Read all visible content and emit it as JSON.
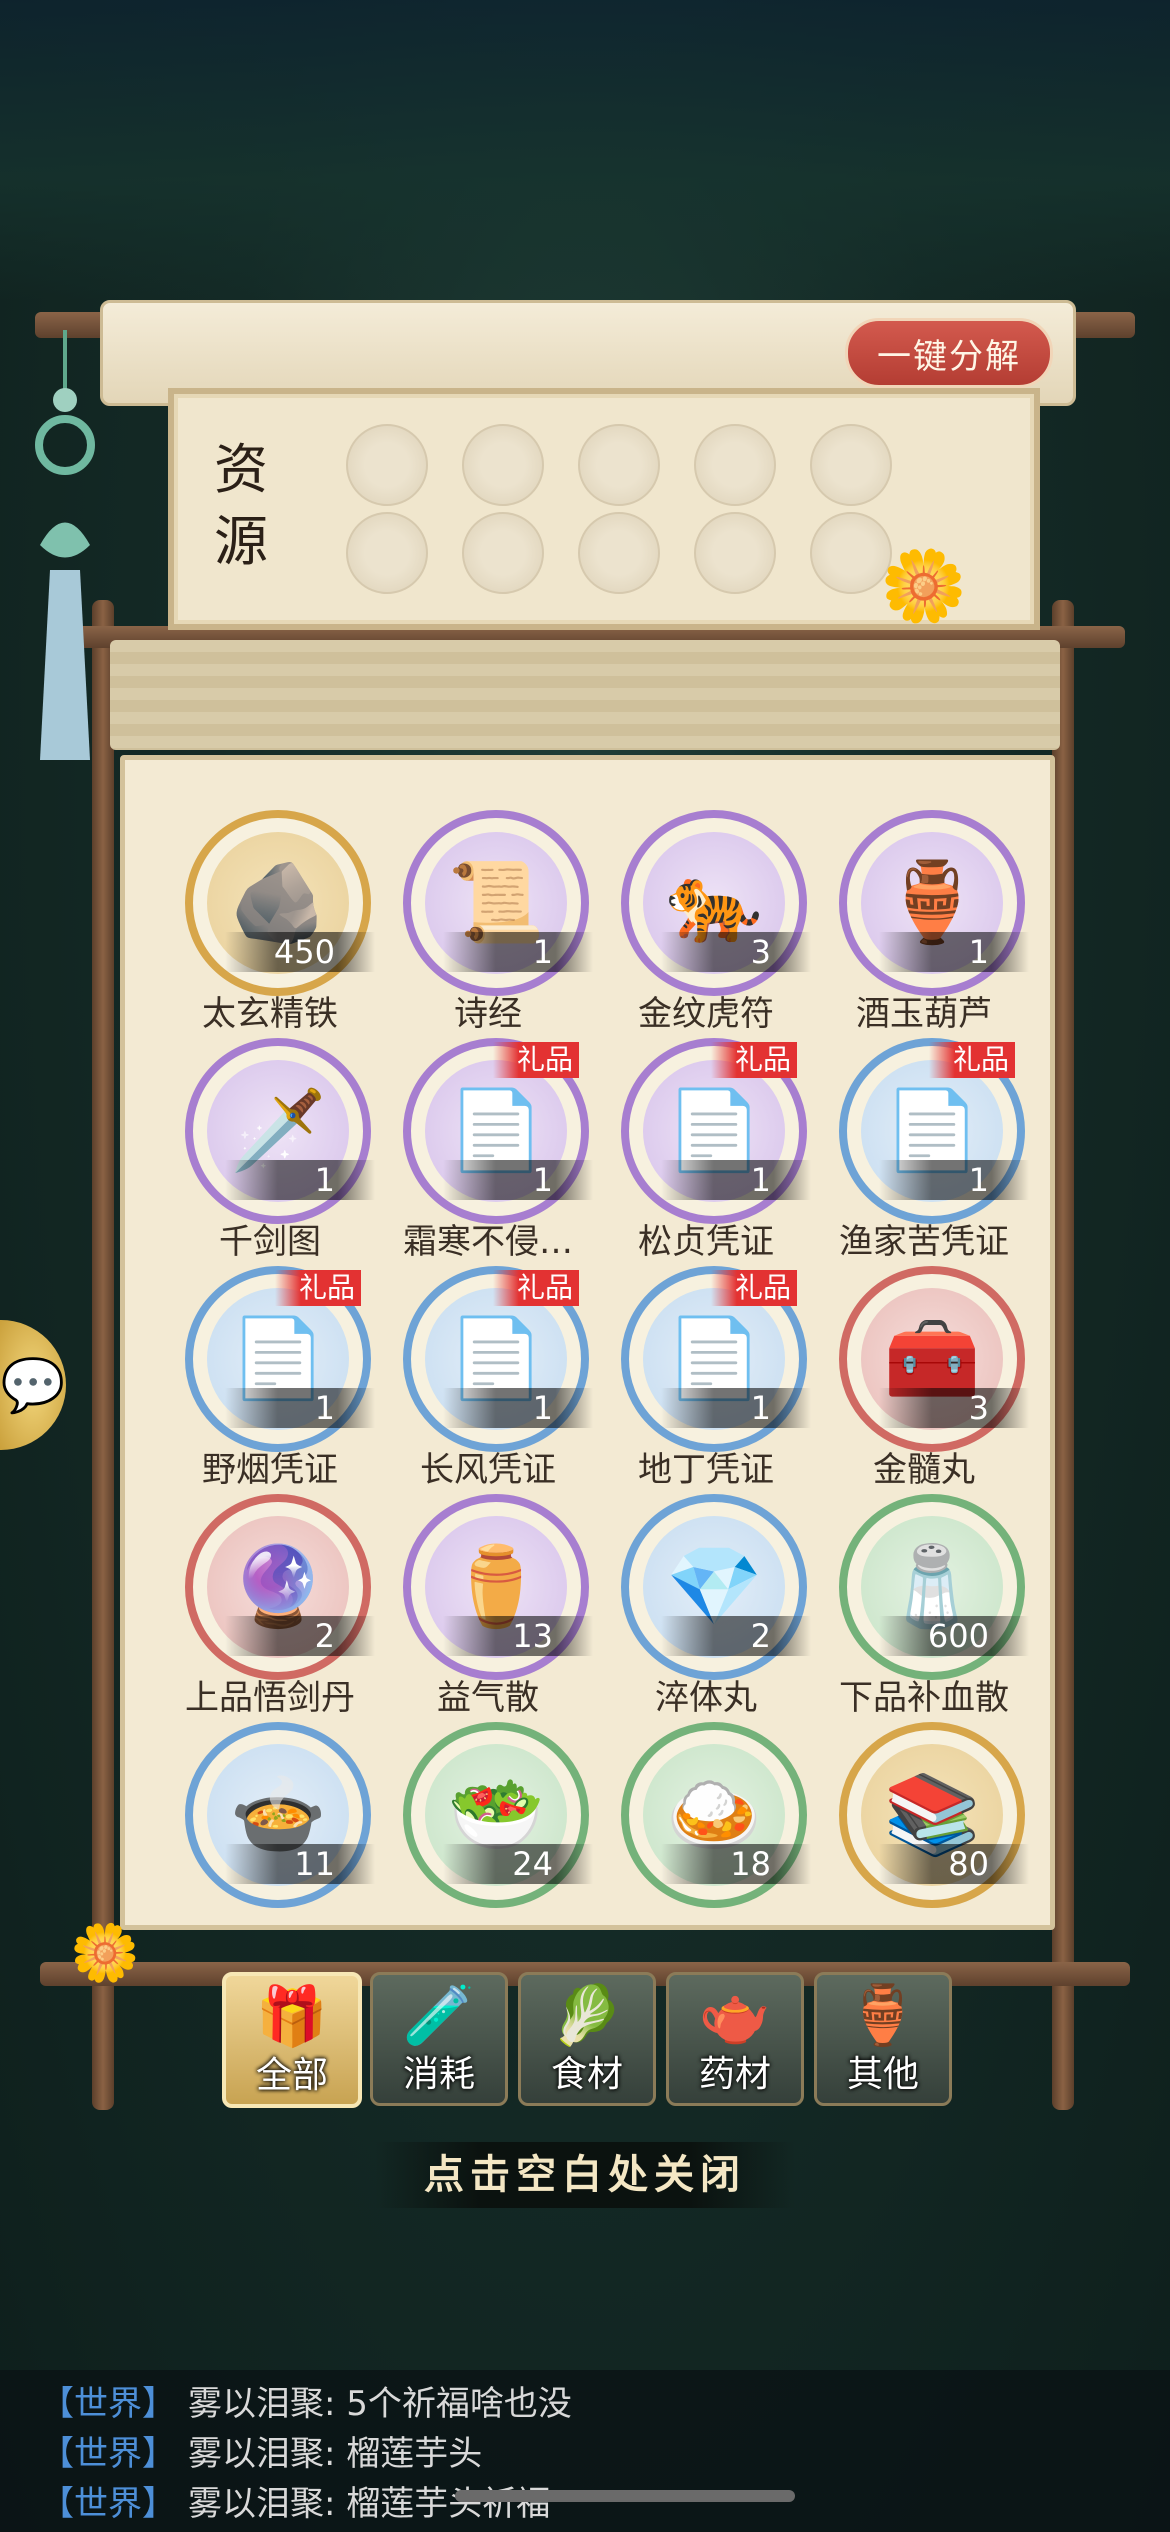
{
  "header": {
    "decompose_label": "一键分解"
  },
  "resource": {
    "title": "资源"
  },
  "items": [
    {
      "name": "太玄精铁",
      "count": "450",
      "icon": "🪨",
      "rarity": "gold",
      "gift": ""
    },
    {
      "name": "诗经",
      "count": "1",
      "icon": "📜",
      "rarity": "purple",
      "gift": ""
    },
    {
      "name": "金纹虎符",
      "count": "3",
      "icon": "🐅",
      "rarity": "purple",
      "gift": ""
    },
    {
      "name": "酒玉葫芦",
      "count": "1",
      "icon": "🏺",
      "rarity": "purple",
      "gift": ""
    },
    {
      "name": "千剑图",
      "count": "1",
      "icon": "🗡️",
      "rarity": "purple",
      "gift": ""
    },
    {
      "name": "霜寒不侵…",
      "count": "1",
      "icon": "📄",
      "rarity": "purple",
      "gift": "礼品"
    },
    {
      "name": "松贞凭证",
      "count": "1",
      "icon": "📄",
      "rarity": "purple",
      "gift": "礼品"
    },
    {
      "name": "渔家苦凭证",
      "count": "1",
      "icon": "📄",
      "rarity": "blue",
      "gift": "礼品"
    },
    {
      "name": "野烟凭证",
      "count": "1",
      "icon": "📄",
      "rarity": "blue",
      "gift": "礼品"
    },
    {
      "name": "长风凭证",
      "count": "1",
      "icon": "📄",
      "rarity": "blue",
      "gift": "礼品"
    },
    {
      "name": "地丁凭证",
      "count": "1",
      "icon": "📄",
      "rarity": "blue",
      "gift": "礼品"
    },
    {
      "name": "金髓丸",
      "count": "3",
      "icon": "🧰",
      "rarity": "red",
      "gift": ""
    },
    {
      "name": "上品悟剑丹",
      "count": "2",
      "icon": "🔮",
      "rarity": "red",
      "gift": ""
    },
    {
      "name": "益气散",
      "count": "13",
      "icon": "⚱️",
      "rarity": "purple",
      "gift": ""
    },
    {
      "name": "淬体丸",
      "count": "2",
      "icon": "💎",
      "rarity": "blue",
      "gift": ""
    },
    {
      "name": "下品补血散",
      "count": "600",
      "icon": "🧂",
      "rarity": "green",
      "gift": ""
    },
    {
      "name": "",
      "count": "11",
      "icon": "🍲",
      "rarity": "blue",
      "gift": ""
    },
    {
      "name": "",
      "count": "24",
      "icon": "🥗",
      "rarity": "green",
      "gift": ""
    },
    {
      "name": "",
      "count": "18",
      "icon": "🍛",
      "rarity": "green",
      "gift": ""
    },
    {
      "name": "",
      "count": "80",
      "icon": "📚",
      "rarity": "gold",
      "gift": ""
    }
  ],
  "tabs": [
    {
      "label": "全部",
      "icon": "🎁",
      "active": true
    },
    {
      "label": "消耗",
      "icon": "🧪",
      "active": false
    },
    {
      "label": "食材",
      "icon": "🥬",
      "active": false
    },
    {
      "label": "药材",
      "icon": "🫖",
      "active": false
    },
    {
      "label": "其他",
      "icon": "🏺",
      "active": false
    }
  ],
  "close_hint": "点击空白处关闭",
  "chat": [
    {
      "tag": "【世界】",
      "speaker": "雾以泪聚:",
      "message": "5个祈福啥也没"
    },
    {
      "tag": "【世界】",
      "speaker": "雾以泪聚:",
      "message": "榴莲芋头"
    },
    {
      "tag": "【世界】",
      "speaker": "雾以泪聚:",
      "message": "榴莲芋头祈福"
    }
  ]
}
